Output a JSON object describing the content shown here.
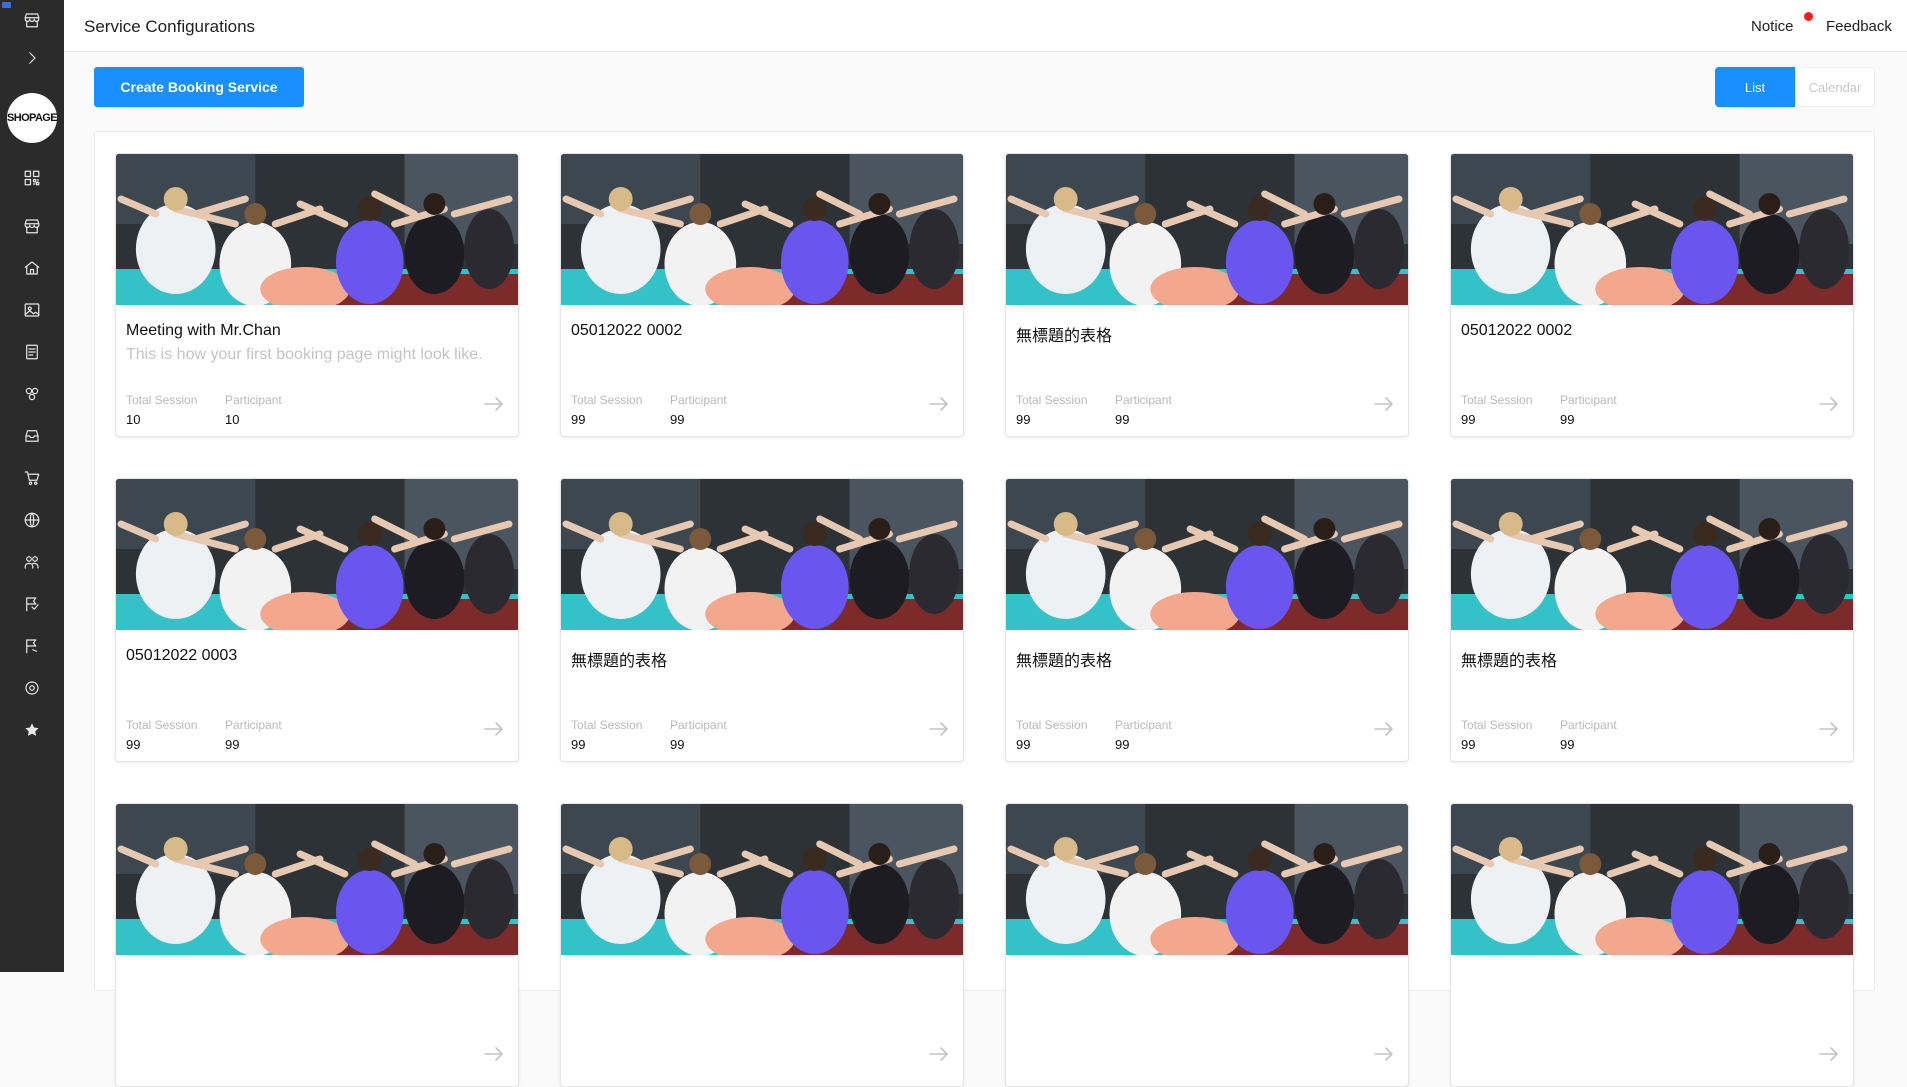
{
  "header": {
    "title": "Service Configurations",
    "notice_label": "Notice",
    "feedback_label": "Feedback"
  },
  "sidebar": {
    "logo_text": "SHOPAGE",
    "items": [
      {
        "name": "store-icon"
      },
      {
        "name": "expand-chevron-icon"
      },
      {
        "name": "qr-code-icon"
      },
      {
        "name": "storefront-icon"
      },
      {
        "name": "home-icon"
      },
      {
        "name": "image-icon"
      },
      {
        "name": "document-icon"
      },
      {
        "name": "integrations-icon"
      },
      {
        "name": "inbox-icon"
      },
      {
        "name": "cart-icon"
      },
      {
        "name": "globe-icon"
      },
      {
        "name": "users-icon"
      },
      {
        "name": "booking-flag-icon"
      },
      {
        "name": "flag-icon"
      },
      {
        "name": "settings-icon"
      },
      {
        "name": "star-icon"
      }
    ]
  },
  "toolbar": {
    "create_label": "Create Booking Service",
    "view_list_label": "List",
    "view_calendar_label": "Calendar"
  },
  "colors": {
    "accent": "#1890ff",
    "sidebar_bg": "#2b2b2b",
    "notice_dot": "#ff1e1e"
  },
  "cards": [
    {
      "title": "Meeting with Mr.Chan",
      "description": "This is how your first booking page might look like.",
      "session_label": "Total Session",
      "session_value": "10",
      "participant_label": "Participant",
      "participant_value": "10"
    },
    {
      "title": "05012022 0002",
      "description": "",
      "session_label": "Total Session",
      "session_value": "99",
      "participant_label": "Participant",
      "participant_value": "99"
    },
    {
      "title": "無標題的表格",
      "description": "",
      "session_label": "Total Session",
      "session_value": "99",
      "participant_label": "Participant",
      "participant_value": "99"
    },
    {
      "title": "05012022 0002",
      "description": "",
      "session_label": "Total Session",
      "session_value": "99",
      "participant_label": "Participant",
      "participant_value": "99"
    },
    {
      "title": "05012022 0003",
      "description": "",
      "session_label": "Total Session",
      "session_value": "99",
      "participant_label": "Participant",
      "participant_value": "99"
    },
    {
      "title": "無標題的表格",
      "description": "",
      "session_label": "Total Session",
      "session_value": "99",
      "participant_label": "Participant",
      "participant_value": "99"
    },
    {
      "title": "無標題的表格",
      "description": "",
      "session_label": "Total Session",
      "session_value": "99",
      "participant_label": "Participant",
      "participant_value": "99"
    },
    {
      "title": "無標題的表格",
      "description": "",
      "session_label": "Total Session",
      "session_value": "99",
      "participant_label": "Participant",
      "participant_value": "99"
    },
    {
      "title": "",
      "description": "",
      "session_label": "",
      "session_value": "",
      "participant_label": "",
      "participant_value": ""
    },
    {
      "title": "",
      "description": "",
      "session_label": "",
      "session_value": "",
      "participant_label": "",
      "participant_value": ""
    },
    {
      "title": "",
      "description": "",
      "session_label": "",
      "session_value": "",
      "participant_label": "",
      "participant_value": ""
    },
    {
      "title": "",
      "description": "",
      "session_label": "",
      "session_value": "",
      "participant_label": "",
      "participant_value": ""
    }
  ]
}
